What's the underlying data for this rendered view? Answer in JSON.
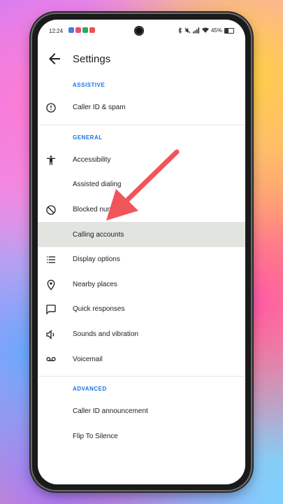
{
  "status_bar": {
    "time": "12:24",
    "battery": "45%",
    "app_icon_colors": [
      "#4a7bd9",
      "#e94e77",
      "#2aa85f",
      "#e8534a"
    ]
  },
  "app_bar": {
    "title": "Settings",
    "back_icon": "arrow-left-icon"
  },
  "sections": [
    {
      "header": "ASSISTIVE",
      "items": [
        {
          "label": "Caller ID & spam",
          "icon": "info-circle-icon"
        }
      ]
    },
    {
      "header": "GENERAL",
      "items": [
        {
          "label": "Accessibility",
          "icon": "accessibility-icon"
        },
        {
          "label": "Assisted dialing",
          "icon": ""
        },
        {
          "label": "Blocked numbers",
          "icon": "block-icon"
        },
        {
          "label": "Calling accounts",
          "icon": "",
          "selected": true
        },
        {
          "label": "Display options",
          "icon": "list-icon"
        },
        {
          "label": "Nearby places",
          "icon": "location-pin-icon"
        },
        {
          "label": "Quick responses",
          "icon": "message-icon"
        },
        {
          "label": "Sounds and vibration",
          "icon": "volume-icon"
        },
        {
          "label": "Voicemail",
          "icon": "voicemail-icon"
        }
      ]
    },
    {
      "header": "ADVANCED",
      "items": [
        {
          "label": "Caller ID announcement",
          "icon": ""
        },
        {
          "label": "Flip To Silence",
          "icon": ""
        }
      ]
    }
  ],
  "colors": {
    "accent": "#1a73e8",
    "selected_row": "#e1e4df",
    "arrow": "#f0555a"
  }
}
